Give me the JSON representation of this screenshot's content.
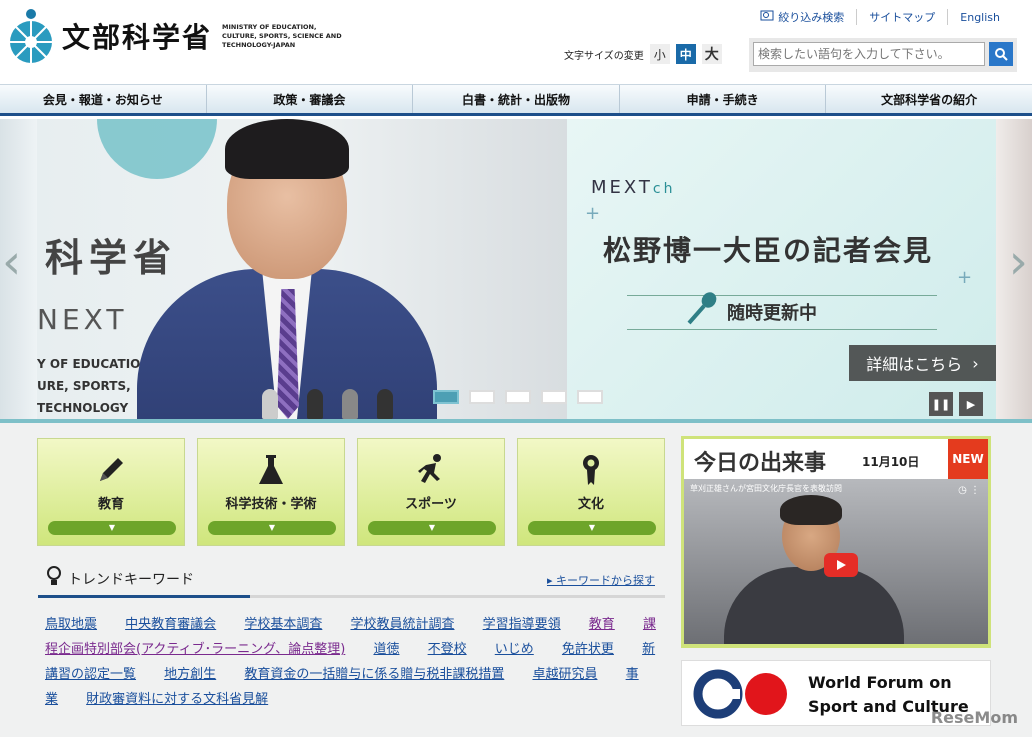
{
  "header": {
    "site_title": "文部科学省",
    "site_title_en": "MINISTRY OF EDUCATION, CULTURE, SPORTS, SCIENCE AND TECHNOLOGY-JAPAN",
    "util_links": [
      "絞り込み検索",
      "サイトマップ",
      "English"
    ],
    "font_size_label": "文字サイズの変更",
    "font_sizes": [
      "小",
      "中",
      "大"
    ],
    "search_placeholder": "検索したい語句を入力して下さい。"
  },
  "nav": {
    "items": [
      "会見・報道・お知らせ",
      "政策・審議会",
      "白書・統計・出版物",
      "申請・手続き",
      "文部科学省の紹介"
    ]
  },
  "hero": {
    "wall_text_1": "科学省",
    "wall_text_2": "NEXT",
    "wall_text_small": [
      "Y OF EDUCATION",
      "URE, SPORTS,",
      "TECHNOLOGY"
    ],
    "channel": "MEXT",
    "channel_suffix": "ch",
    "title": "松野博一大臣の記者会見",
    "subtitle": "随時更新中",
    "detail_button": "詳細はこちら"
  },
  "categories": [
    "教育",
    "科学技術・学術",
    "スポーツ",
    "文化"
  ],
  "trend": {
    "title": "トレンドキーワード",
    "more_link": "キーワードから探す",
    "keywords": [
      {
        "label": "鳥取地震",
        "visited": false
      },
      {
        "label": "中央教育審議会",
        "visited": false
      },
      {
        "label": "学校基本調査",
        "visited": false
      },
      {
        "label": "学校教員統計調査",
        "visited": false
      },
      {
        "label": "学習指導要領",
        "visited": false
      },
      {
        "label": "教育",
        "visited": true
      },
      {
        "label": "課程企画特別部会(アクティブ･ラーニング、論点整理)",
        "visited": true
      },
      {
        "label": "道徳",
        "visited": false
      },
      {
        "label": "不登校",
        "visited": false
      },
      {
        "label": "いじめ",
        "visited": false
      },
      {
        "label": "免許状更",
        "visited": false
      },
      {
        "label": "新講習の認定一覧",
        "visited": false
      },
      {
        "label": "地方創生",
        "visited": false
      },
      {
        "label": "教育資金の一括贈与に係る贈与税非課税措置",
        "visited": false
      },
      {
        "label": "卓越研究員",
        "visited": false
      },
      {
        "label": "事業",
        "visited": false
      },
      {
        "label": "財政審資料に対する文科省見解",
        "visited": false
      }
    ]
  },
  "news": {
    "title": "今日の出来事",
    "date": "11月10日",
    "badge": "NEW",
    "video_caption": "草刈正雄さんが宮田文化庁長官を表敬訪問"
  },
  "banner": {
    "text_line1": "World Forum on",
    "text_line2": "Sport and Culture"
  },
  "watermark": "ReseMom"
}
